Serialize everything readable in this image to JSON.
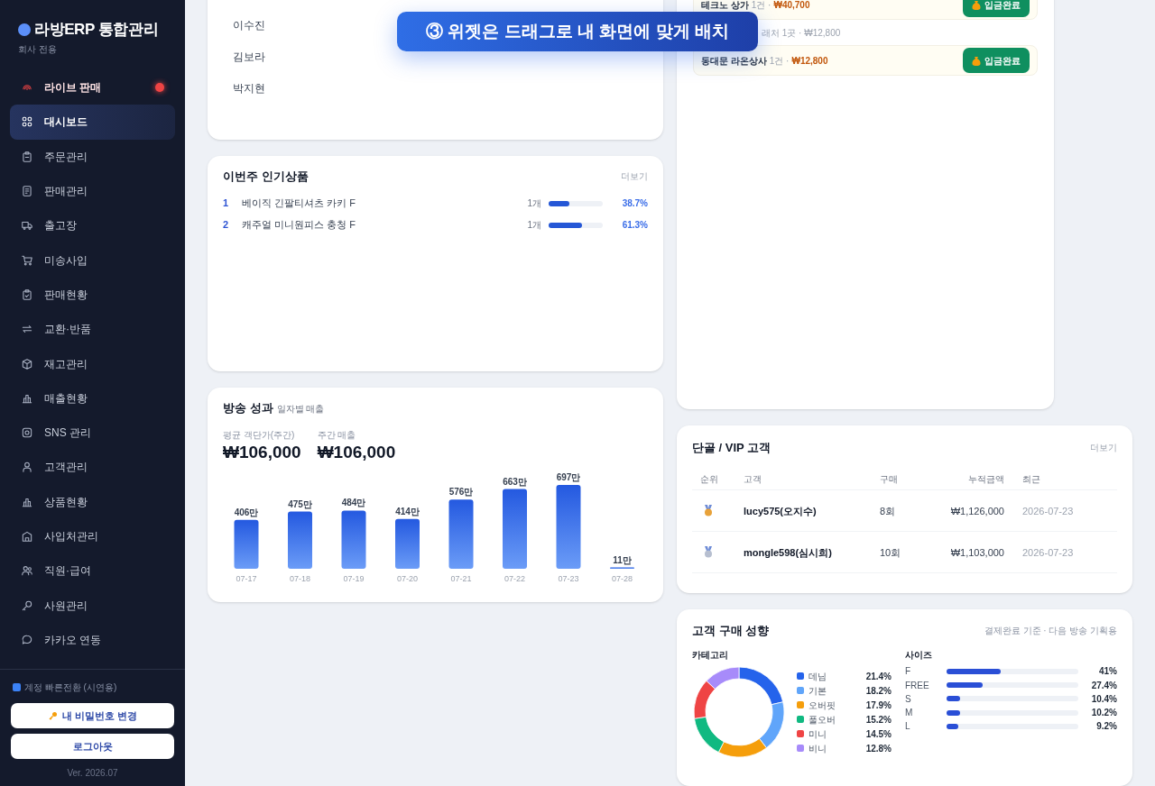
{
  "sidebar": {
    "logo": "라방ERP 통합관리",
    "subtitle": "회사 전용",
    "items": [
      {
        "label": "라이브 판매",
        "kind": "live",
        "selected": false
      },
      {
        "label": "대시보드",
        "kind": "nav",
        "selected": true
      },
      {
        "label": "주문관리",
        "kind": "nav",
        "selected": false
      },
      {
        "label": "판매관리",
        "kind": "nav",
        "selected": false
      },
      {
        "label": "출고장",
        "kind": "nav",
        "selected": false
      },
      {
        "label": "미송사입",
        "kind": "nav",
        "selected": false
      },
      {
        "label": "판매현황",
        "kind": "nav",
        "selected": false
      },
      {
        "label": "교환·반품",
        "kind": "nav",
        "selected": false
      },
      {
        "label": "재고관리",
        "kind": "nav",
        "selected": false
      },
      {
        "label": "매출현황",
        "kind": "nav",
        "selected": false
      },
      {
        "label": "SNS 관리",
        "kind": "nav",
        "selected": false
      },
      {
        "label": "고객관리",
        "kind": "nav",
        "selected": false
      },
      {
        "label": "상품현황",
        "kind": "nav",
        "selected": false
      },
      {
        "label": "사입처관리",
        "kind": "nav",
        "selected": false
      },
      {
        "label": "직원·급여",
        "kind": "nav",
        "selected": false
      },
      {
        "label": "사원관리",
        "kind": "nav",
        "selected": false
      },
      {
        "label": "카카오 연동",
        "kind": "nav",
        "selected": false
      }
    ],
    "account_switch": "계정 빠른전환 (시연용)",
    "buttons": [
      {
        "label": "내 비밀번호 변경",
        "kind": "password"
      },
      {
        "label": "로그아웃",
        "kind": "logout"
      }
    ],
    "version": "Ver. 2026.07"
  },
  "banner": "③ 위젯은 드래그로 내 화면에 맞게 배치",
  "staff_card": {
    "names": [
      "이수진",
      "김보라",
      "박지현"
    ]
  },
  "popular_products": {
    "title": "이번주 인기상품",
    "more": "더보기",
    "rows": [
      {
        "rank": "1",
        "name": "베이직 긴팔티셔츠 카키 F",
        "qty": "1개",
        "level": 0.387,
        "percent": "38.7%"
      },
      {
        "rank": "2",
        "name": "캐주얼 미니원피스 충청 F",
        "qty": "1개",
        "level": 0.613,
        "percent": "61.3%"
      }
    ]
  },
  "broadcast": {
    "title": "방송 성과",
    "subtitle": "일자별 매출",
    "stats": [
      {
        "label": "평균 객단가(주간)",
        "value": "₩106,000"
      },
      {
        "label": "주간 매출",
        "value": "₩106,000"
      }
    ],
    "chart_data": {
      "type": "bar",
      "categories": [
        "07-17",
        "07-18",
        "07-19",
        "07-20",
        "07-21",
        "07-22",
        "07-23",
        "07-28"
      ],
      "values": [
        406,
        475,
        484,
        414,
        576,
        663,
        697,
        11
      ],
      "value_labels": [
        "406만",
        "475만",
        "484만",
        "414만",
        "576만",
        "663만",
        "697만",
        "11만"
      ]
    }
  },
  "deposits": {
    "rows": [
      {
        "kind": "paid",
        "name": "테크노 상가",
        "count": "1건 ·",
        "amount": "₩40,700",
        "button": "입금완료"
      },
      {
        "kind": "summary",
        "text": "래처 1곳 · ₩12,800"
      },
      {
        "kind": "paid",
        "name": "동대문 라온상사",
        "count": "1건 ·",
        "amount": "₩12,800",
        "button": "입금완료"
      }
    ]
  },
  "vip": {
    "title": "단골 / VIP 고객",
    "more": "더보기",
    "columns": [
      "순위",
      "고객",
      "구매",
      "누적금액",
      "최근"
    ],
    "rows": [
      {
        "kind": "gold",
        "customer": "lucy575(오지수)",
        "purchases": "8회",
        "total": "₩1,126,000",
        "recent": "2026-07-23"
      },
      {
        "kind": "silver",
        "customer": "mongle598(심시희)",
        "purchases": "10회",
        "total": "₩1,103,000",
        "recent": "2026-07-23"
      }
    ]
  },
  "tendency": {
    "title": "고객 구매 성향",
    "note": "결제완료 기준 · 다음 방송 기획용",
    "category_title": "카테고리",
    "categories": [
      {
        "name": "데님",
        "color": "#2563eb",
        "percent": "21.4%"
      },
      {
        "name": "기본",
        "color": "#60a5fa",
        "percent": "18.2%"
      },
      {
        "name": "오버핏",
        "color": "#f59e0b",
        "percent": "17.9%"
      },
      {
        "name": "풀오버",
        "color": "#10b981",
        "percent": "15.2%"
      },
      {
        "name": "미니",
        "color": "#ef4444",
        "percent": "14.5%"
      },
      {
        "name": "비니",
        "color": "#a78bfa",
        "percent": "12.8%"
      }
    ],
    "size_title": "사이즈",
    "sizes": [
      {
        "name": "F",
        "level": 0.41,
        "percent": "41%"
      },
      {
        "name": "FREE",
        "level": 0.274,
        "percent": "27.4%"
      },
      {
        "name": "S",
        "level": 0.104,
        "percent": "10.4%"
      },
      {
        "name": "M",
        "level": 0.102,
        "percent": "10.2%"
      },
      {
        "name": "L",
        "level": 0.092,
        "percent": "9.2%"
      }
    ]
  }
}
